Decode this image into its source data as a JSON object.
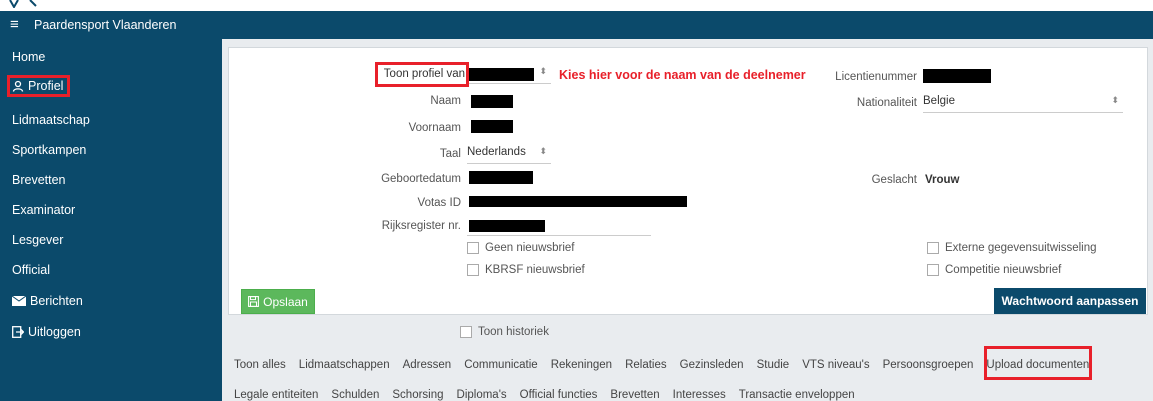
{
  "app": {
    "brand": "Paardensport Vlaanderen"
  },
  "sidebar": {
    "items": [
      {
        "label": "Home",
        "icon": ""
      },
      {
        "label": "Profiel",
        "icon": "user-icon"
      },
      {
        "label": "Lidmaatschap",
        "icon": ""
      },
      {
        "label": "Sportkampen",
        "icon": ""
      },
      {
        "label": "Brevetten",
        "icon": ""
      },
      {
        "label": "Examinator",
        "icon": ""
      },
      {
        "label": "Lesgever",
        "icon": ""
      },
      {
        "label": "Official",
        "icon": ""
      },
      {
        "label": "Berichten",
        "icon": "envelope-icon"
      },
      {
        "label": "Uitloggen",
        "icon": "logout-icon"
      }
    ]
  },
  "form": {
    "toon_profiel_label": "Toon profiel van",
    "hint": "Kies hier voor de naam van de deelnemer",
    "naam_label": "Naam",
    "voornaam_label": "Voornaam",
    "taal_label": "Taal",
    "taal_value": "Nederlands",
    "geboortedatum_label": "Geboortedatum",
    "votas_label": "Votas ID",
    "rijksregister_label": "Rijksregister nr.",
    "licentie_label": "Licentienummer",
    "nationaliteit_label": "Nationaliteit",
    "nationaliteit_value": "Belgie",
    "geslacht_label": "Geslacht",
    "geslacht_value": "Vrouw",
    "geen_nieuwsbrief": "Geen nieuwsbrief",
    "kbrsf_nieuwsbrief": "KBRSF nieuwsbrief",
    "externe": "Externe gegevensuitwisseling",
    "competitie": "Competitie nieuwsbrief",
    "save_label": "Opslaan",
    "password_label": "Wachtwoord aanpassen"
  },
  "history": {
    "label": "Toon historiek"
  },
  "tabs_row1": [
    "Toon alles",
    "Lidmaatschappen",
    "Adressen",
    "Communicatie",
    "Rekeningen",
    "Relaties",
    "Gezinsleden",
    "Studie",
    "VTS niveau's",
    "Persoonsgroepen",
    "Upload documenten"
  ],
  "tabs_row2": [
    "Legale entiteiten",
    "Schulden",
    "Schorsing",
    "Diploma's",
    "Official functies",
    "Brevetten",
    "Interesses",
    "Transactie enveloppen"
  ],
  "colors": {
    "brand": "#0b4a6b",
    "highlight": "#e8202a",
    "save": "#5cb85c"
  }
}
